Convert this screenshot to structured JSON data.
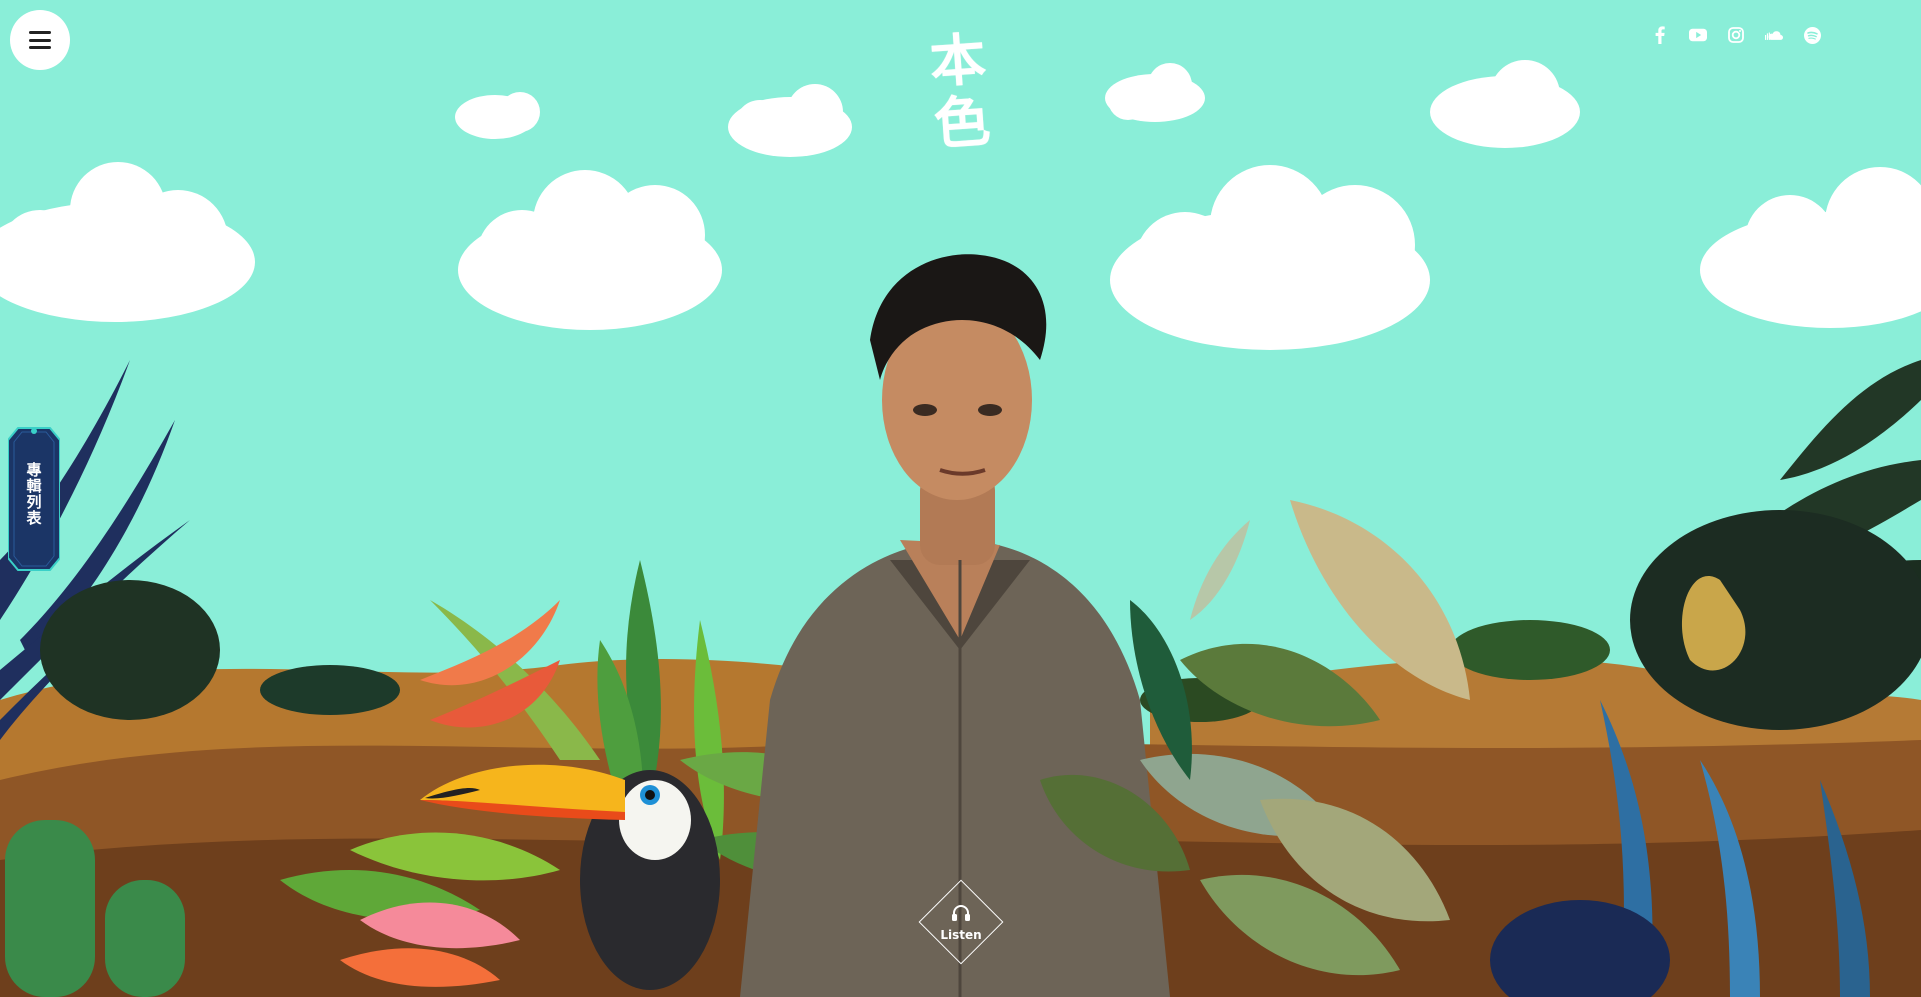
{
  "header": {
    "logo_char_1": "本",
    "logo_char_2": "色"
  },
  "menu": {
    "icon": "hamburger-menu-icon"
  },
  "social": [
    {
      "name": "facebook",
      "icon": "facebook-icon"
    },
    {
      "name": "youtube",
      "icon": "youtube-icon"
    },
    {
      "name": "instagram",
      "icon": "instagram-icon"
    },
    {
      "name": "soundcloud",
      "icon": "soundcloud-icon"
    },
    {
      "name": "spotify",
      "icon": "spotify-icon"
    }
  ],
  "side_tab": {
    "label": "專輯列表"
  },
  "listen": {
    "label": "Listen",
    "icon": "headphones-icon"
  },
  "colors": {
    "sky": "#8aeed8",
    "cloud": "#ffffff",
    "hill": "#a86a2a",
    "tab_bg": "#1b3566"
  }
}
